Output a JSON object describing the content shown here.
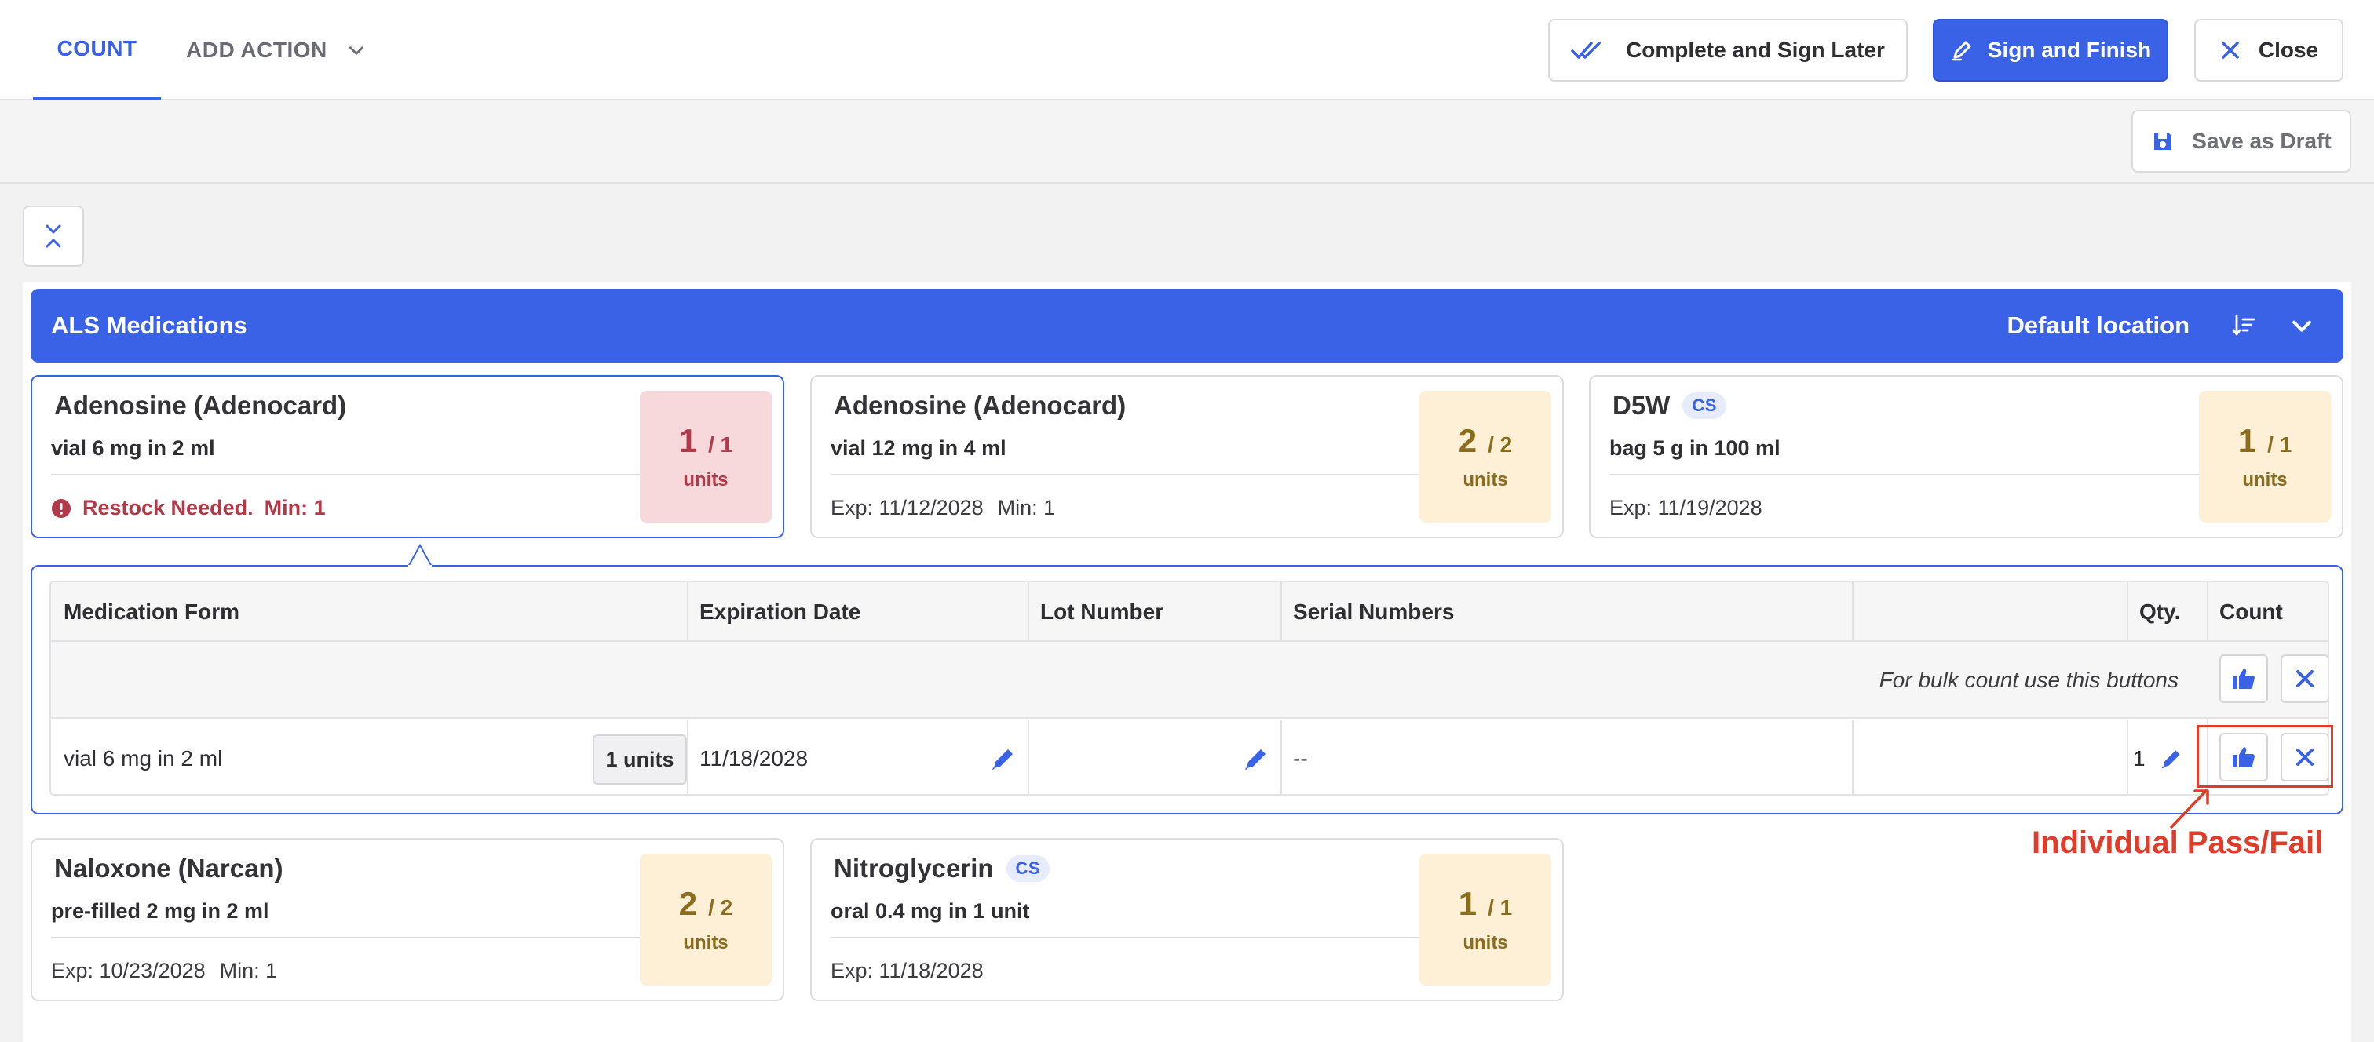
{
  "header": {
    "tabs": [
      {
        "label": "COUNT",
        "active": true
      },
      {
        "label": "ADD ACTION",
        "active": false
      }
    ],
    "complete_sign_later_label": "Complete and Sign Later",
    "sign_finish_label": "Sign and Finish",
    "close_label": "Close",
    "save_draft_label": "Save as Draft"
  },
  "group": {
    "title": "ALS Medications",
    "location": "Default location"
  },
  "cards": [
    {
      "name": "Adenosine (Adenocard)",
      "cs": "",
      "desc": "vial 6 mg in 2 ml",
      "exp": "",
      "min": "Min: 1",
      "warning": "Restock Needed.",
      "count": "1",
      "of": "/ 1",
      "unit": "units",
      "status": "low"
    },
    {
      "name": "Adenosine (Adenocard)",
      "cs": "",
      "desc": "vial 12 mg in 4 ml",
      "exp": "Exp: 11/12/2028",
      "min": "Min: 1",
      "warning": "",
      "count": "2",
      "of": "/ 2",
      "unit": "units",
      "status": "ok"
    },
    {
      "name": "D5W",
      "cs": "CS",
      "desc": "bag 5 g in 100 ml",
      "exp": "Exp: 11/19/2028",
      "min": "",
      "warning": "",
      "count": "1",
      "of": "/ 1",
      "unit": "units",
      "status": "ok"
    },
    {
      "name": "Naloxone (Narcan)",
      "cs": "",
      "desc": "pre-filled 2 mg in 2 ml",
      "exp": "Exp: 10/23/2028",
      "min": "Min: 1",
      "warning": "",
      "count": "2",
      "of": "/ 2",
      "unit": "units",
      "status": "ok"
    },
    {
      "name": "Nitroglycerin",
      "cs": "CS",
      "desc": "oral 0.4 mg in 1 unit",
      "exp": "Exp: 11/18/2028",
      "min": "",
      "warning": "",
      "count": "1",
      "of": "/ 1",
      "unit": "units",
      "status": "ok"
    }
  ],
  "detail": {
    "columns": [
      "Medication Form",
      "Expiration Date",
      "Lot Number",
      "Serial Numbers",
      "",
      "Qty.",
      "Count"
    ],
    "bulk_hint": "For bulk count use this buttons",
    "row": {
      "form": "vial 6 mg in 2 ml",
      "units": "1 units",
      "expiration": "11/18/2028",
      "lot": "",
      "serials": "--",
      "qty": "1"
    }
  },
  "annotation": {
    "text": "Individual Pass/Fail"
  },
  "colors": {
    "accent": "#3a62e6",
    "warning": "#b23a48",
    "ok_bg": "#fdf0d6",
    "low_bg": "#f8d9db",
    "annotation": "#e03c2a"
  }
}
